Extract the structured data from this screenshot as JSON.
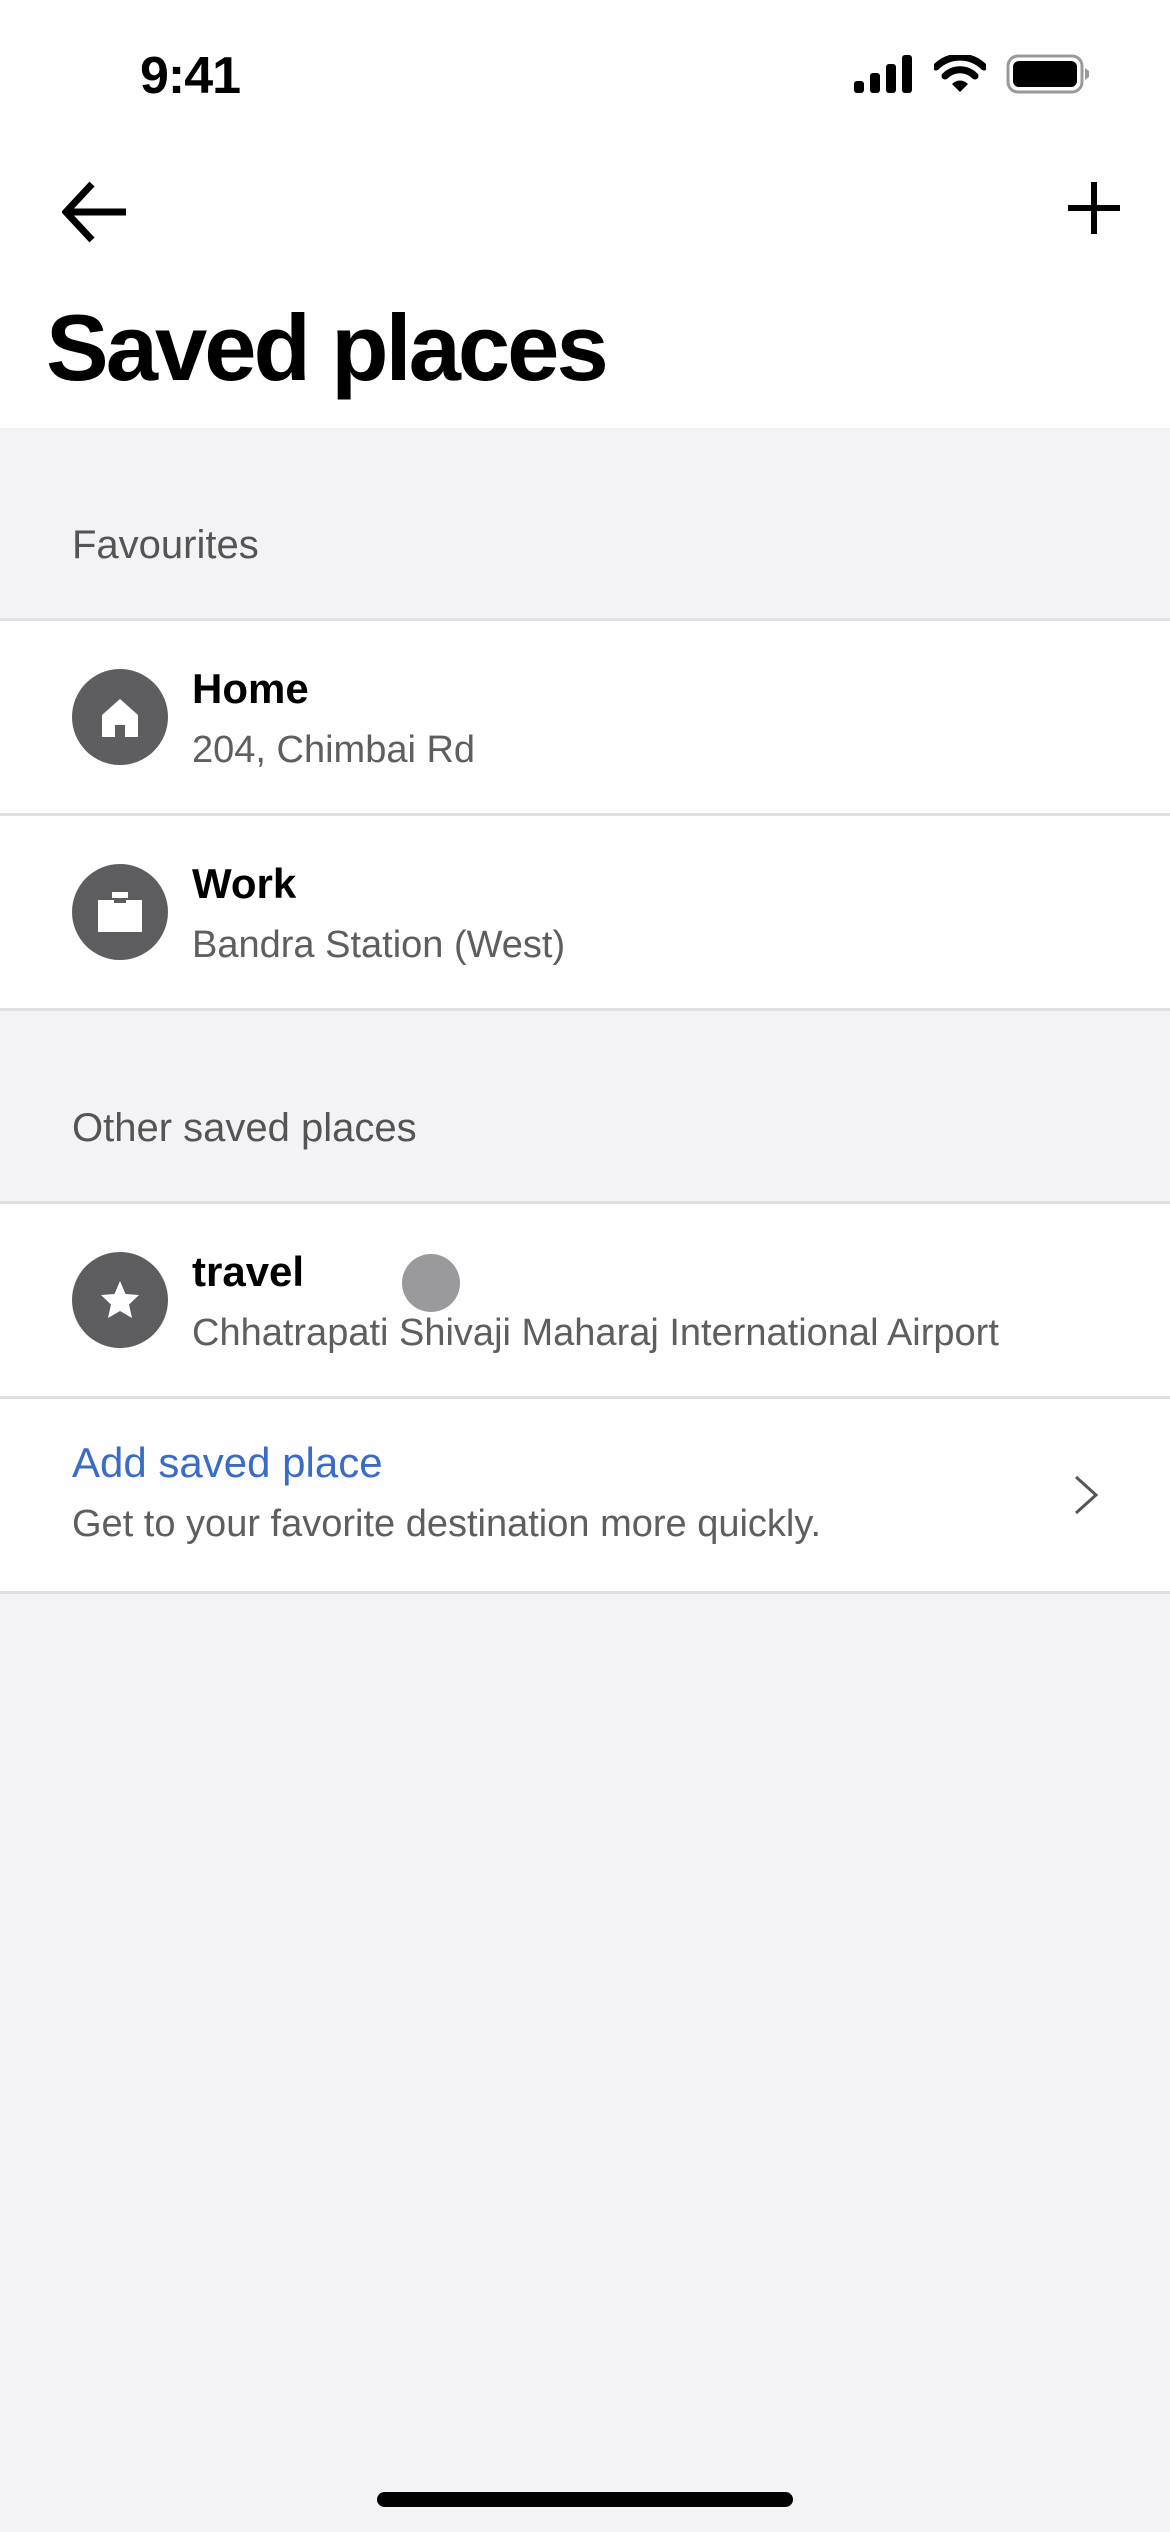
{
  "status_bar": {
    "time": "9:41",
    "icons": [
      "cellular-signal-icon",
      "wifi-icon",
      "battery-icon"
    ]
  },
  "nav": {
    "back_icon": "arrow-left-icon",
    "add_icon": "plus-icon"
  },
  "page": {
    "title": "Saved places"
  },
  "sections": {
    "favourites": {
      "header": "Favourites",
      "items": [
        {
          "icon": "home-icon",
          "name": "Home",
          "address": "204, Chimbai Rd"
        },
        {
          "icon": "briefcase-icon",
          "name": "Work",
          "address": "Bandra Station (West)"
        }
      ]
    },
    "other": {
      "header": "Other saved places",
      "items": [
        {
          "icon": "star-icon",
          "name": "travel",
          "address": "Chhatrapati Shivaji Maharaj International Airport"
        }
      ],
      "add": {
        "label": "Add saved place",
        "description": "Get to your favorite destination more quickly."
      }
    }
  },
  "colors": {
    "accent_link": "#3a6cc6",
    "icon_circle": "#5e5d60",
    "background": "#f3f2f5"
  }
}
